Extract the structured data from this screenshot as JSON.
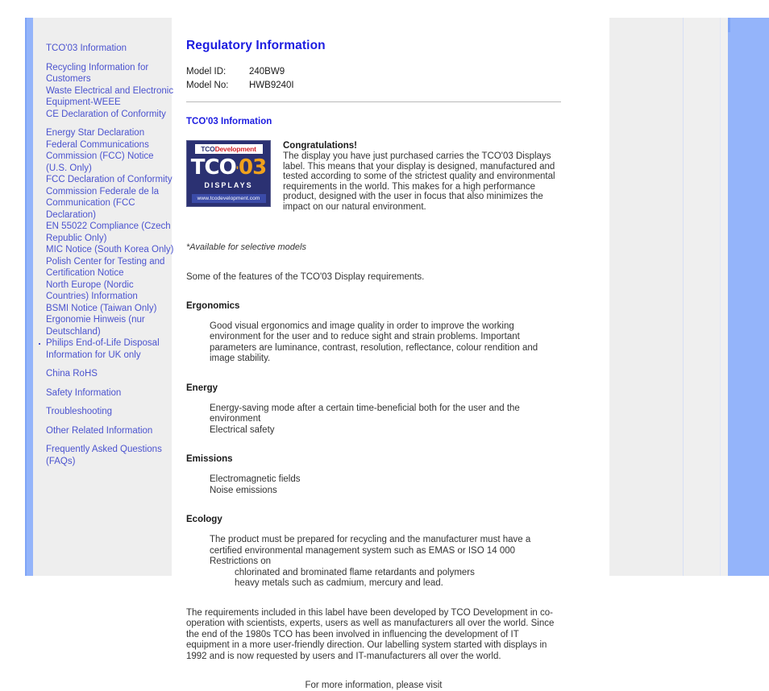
{
  "sidebar": {
    "groups": [
      {
        "items": [
          {
            "label": "TCO'03 Information",
            "marked": false
          }
        ]
      },
      {
        "items": [
          {
            "label": "Recycling Information for Customers",
            "marked": false
          },
          {
            "label": "Waste Electrical and Electronic Equipment-WEEE",
            "marked": false
          },
          {
            "label": "CE Declaration of Conformity",
            "marked": false
          }
        ]
      },
      {
        "items": [
          {
            "label": "Energy Star Declaration",
            "marked": false
          },
          {
            "label": "Federal Communications Commission (FCC) Notice (U.S. Only)",
            "marked": false
          },
          {
            "label": "FCC Declaration of Conformity",
            "marked": false
          },
          {
            "label": "Commission Federale de la Communication (FCC Declaration)",
            "marked": false
          },
          {
            "label": "EN 55022 Compliance (Czech Republic Only)",
            "marked": false
          },
          {
            "label": "MIC Notice (South Korea Only)",
            "marked": false
          },
          {
            "label": "Polish Center for Testing and Certification Notice",
            "marked": false
          },
          {
            "label": "North Europe (Nordic Countries) Information",
            "marked": false
          },
          {
            "label": "BSMI Notice (Taiwan Only)",
            "marked": false
          },
          {
            "label": "Ergonomie Hinweis (nur Deutschland)",
            "marked": false
          },
          {
            "label": "Philips End-of-Life Disposal",
            "marked": true
          },
          {
            "label": "Information for UK only",
            "marked": false
          }
        ]
      },
      {
        "items": [
          {
            "label": "China RoHS",
            "marked": false
          }
        ]
      },
      {
        "items": [
          {
            "label": "Safety Information",
            "marked": false
          }
        ]
      },
      {
        "items": [
          {
            "label": "Troubleshooting",
            "marked": false
          }
        ]
      },
      {
        "items": [
          {
            "label": "Other Related Information",
            "marked": false
          }
        ]
      },
      {
        "items": [
          {
            "label": "Frequently Asked Questions (FAQs)",
            "marked": false
          }
        ]
      }
    ]
  },
  "main": {
    "title": "Regulatory Information",
    "model": {
      "id_label": "Model ID:",
      "id_value": "240BW9",
      "no_label": "Model No:",
      "no_value": "HWB9240I"
    },
    "section_heading": "TCO'03 Information",
    "logo": {
      "top_text_1": "TCO",
      "top_text_2": "Development",
      "mark_word": "TCO",
      "mark_apostrophe": "'",
      "mark_year": "03",
      "displays": "DISPLAYS",
      "url": "www.tcodevelopment.com"
    },
    "congratulations_heading": "Congratulations!",
    "congratulations_body": "The display you have just purchased carries the TCO'03 Displays label. This means that your display is designed, manufactured and tested according to some of the strictest quality and environmental requirements in the world. This makes for a high performance product, designed with the user in focus that also minimizes the impact on our natural environment.",
    "available_note": "*Available for selective models",
    "features_intro": "Some of the features of the TCO'03 Display requirements.",
    "sections": {
      "ergonomics_heading": "Ergonomics",
      "ergonomics_body": "Good visual ergonomics and image quality in order to improve the working environment for the user and to reduce sight and strain problems. Important parameters are luminance, contrast, resolution, reflectance, colour rendition and image stability.",
      "energy_heading": "Energy",
      "energy_line_1": "Energy-saving mode after a certain time-beneficial both for the user and the environment",
      "energy_line_2": "Electrical safety",
      "emissions_heading": "Emissions",
      "emissions_line_1": "Electromagnetic fields",
      "emissions_line_2": "Noise emissions",
      "ecology_heading": "Ecology",
      "ecology_line_1": "The product must be prepared for recycling and the manufacturer must have a certified environmental management system such as EMAS or ISO 14 000",
      "ecology_line_2": "Restrictions on",
      "ecology_sub_1": "chlorinated and brominated flame retardants and polymers",
      "ecology_sub_2": "heavy metals such as cadmium, mercury and lead."
    },
    "closing_paragraph": "The requirements included in this label have been developed by TCO Development in co-operation with scientists, experts, users as well as manufacturers all over the world. Since the end of the 1980s TCO has been involved in influencing the development of IT equipment in a more user-friendly direction. Our labelling system started with displays in 1992 and is now requested by users and IT-manufacturers all over the world.",
    "more_info": "For more information, please visit"
  },
  "colors": {
    "link": "#4b53cf",
    "heading": "#1c1ce0",
    "rail": "#94b4fa",
    "panel": "#eeeeee"
  }
}
